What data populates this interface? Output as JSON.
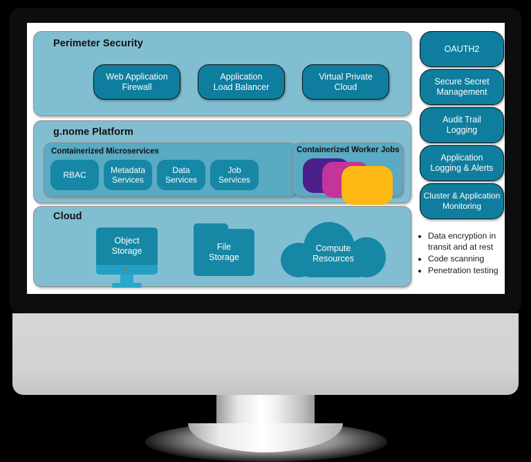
{
  "diagram": {
    "layers": [
      {
        "id": "perimeter-security",
        "title": "Perimeter Security",
        "items": [
          {
            "label": "Web Application\nFirewall"
          },
          {
            "label": "Application\nLoad Balancer"
          },
          {
            "label": "Virtual Private\nCloud"
          }
        ]
      },
      {
        "id": "gnome-platform",
        "title": "g.nome Platform",
        "groups": [
          {
            "id": "containerized-microservices",
            "title": "Containerized Microservices",
            "items": [
              {
                "label": "RBAC"
              },
              {
                "label": "Metadata\nServices"
              },
              {
                "label": "Data\nServices"
              },
              {
                "label": "Job\nServices"
              }
            ]
          },
          {
            "id": "containerized-worker-jobs",
            "title": "Containerized Worker Jobs",
            "jobs": [
              {
                "name": "worker-job-purple",
                "color": "#4B1F8C"
              },
              {
                "name": "worker-job-magenta",
                "color": "#C3359A"
              },
              {
                "name": "worker-job-orange",
                "color": "#FEB813"
              }
            ]
          }
        ]
      },
      {
        "id": "cloud",
        "title": "Cloud",
        "items": [
          {
            "label": "Object\nStorage",
            "icon": "desktop-monitor-icon"
          },
          {
            "label": "File\nStorage",
            "icon": "folder-icon"
          },
          {
            "label": "Compute\nResources",
            "icon": "cloud-icon"
          }
        ]
      }
    ],
    "sidebar": {
      "pills": [
        {
          "label": "OAUTH2"
        },
        {
          "label": "Secure Secret\nManagement"
        },
        {
          "label": "Audit Trail\nLogging"
        },
        {
          "label": "Application\nLogging & Alerts"
        },
        {
          "label": "Cluster & Application\nMonitoring"
        }
      ],
      "bullets": [
        "Data encryption in transit and at rest",
        "Code scanning",
        "Penetration testing"
      ]
    },
    "colors": {
      "panel_bg": "#82BED2",
      "subpanel_bg": "#59AAC2",
      "pill_fill": "#0F7E9E",
      "chip_fill": "#1787A6",
      "screen_bg": "#FFFFFF",
      "bezel": "#0D0D0D",
      "stand": "#D6D6D6"
    }
  }
}
